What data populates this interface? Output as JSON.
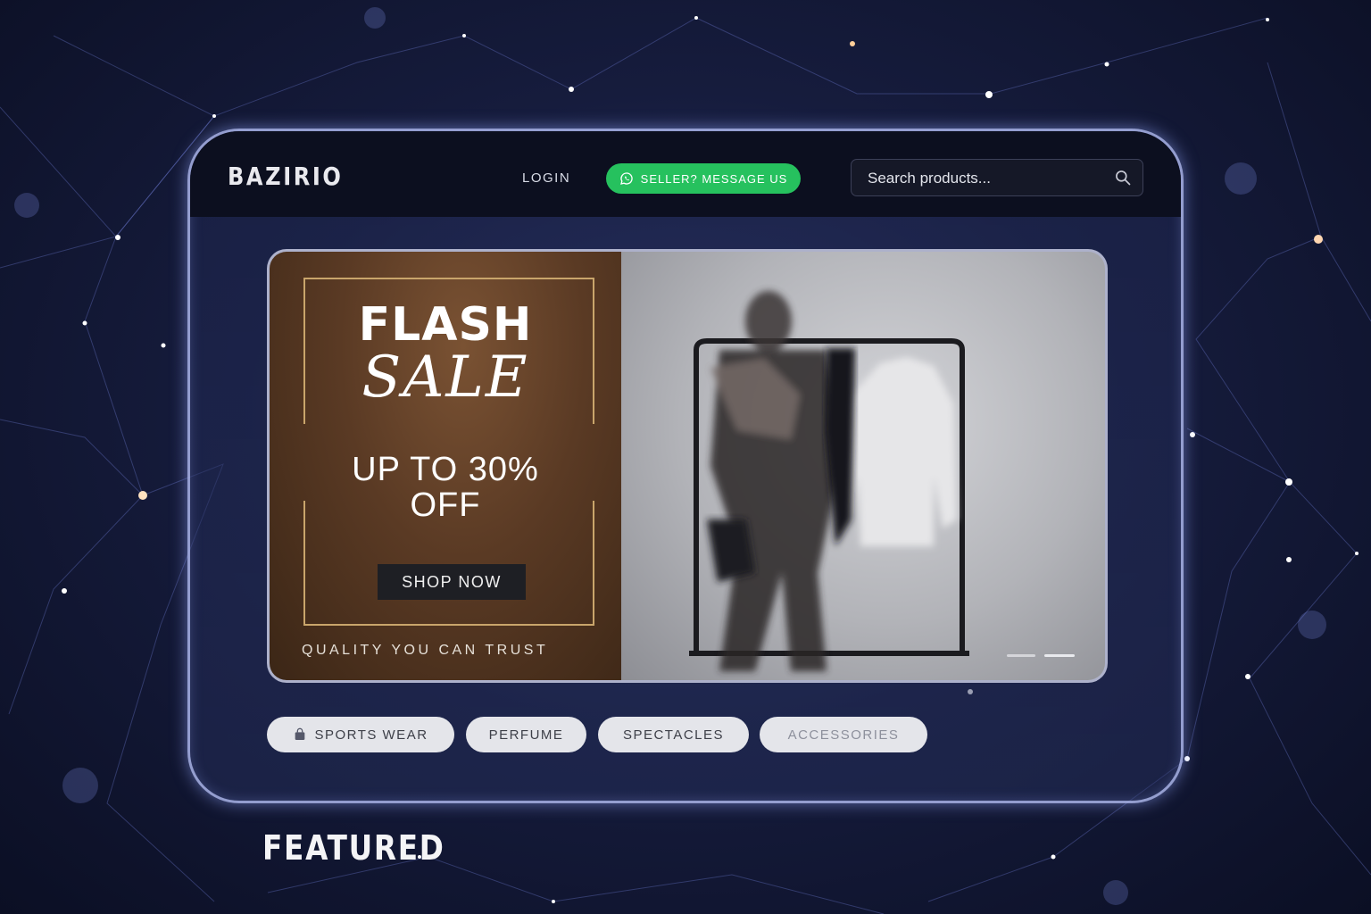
{
  "header": {
    "logo": "BAZIRIO",
    "login_label": "LOGIN",
    "seller_button_label": "SELLER? MESSAGE US",
    "seller_icon": "whatsapp-icon",
    "search_placeholder": "Search products...",
    "search_icon": "search-icon"
  },
  "banner": {
    "title_line1": "FLASH",
    "title_line2": "SALE",
    "discount_line1": "UP TO 30%",
    "discount_line2": "OFF",
    "cta_label": "SHOP NOW",
    "tagline": "QUALITY YOU CAN TRUST",
    "carousel_dots": 2,
    "active_dot": 2
  },
  "categories": [
    {
      "label": "SPORTS WEAR",
      "icon": "shopping-bag-icon"
    },
    {
      "label": "PERFUME"
    },
    {
      "label": "SPECTACLES"
    },
    {
      "label": "ACCESSORIES"
    }
  ],
  "section_title": "FEATURED",
  "colors": {
    "accent_green": "#26c15e",
    "navbar_bg": "#0c0f1f",
    "promo_brown": "#5a3a24",
    "gold_frame": "#c9a56b"
  }
}
